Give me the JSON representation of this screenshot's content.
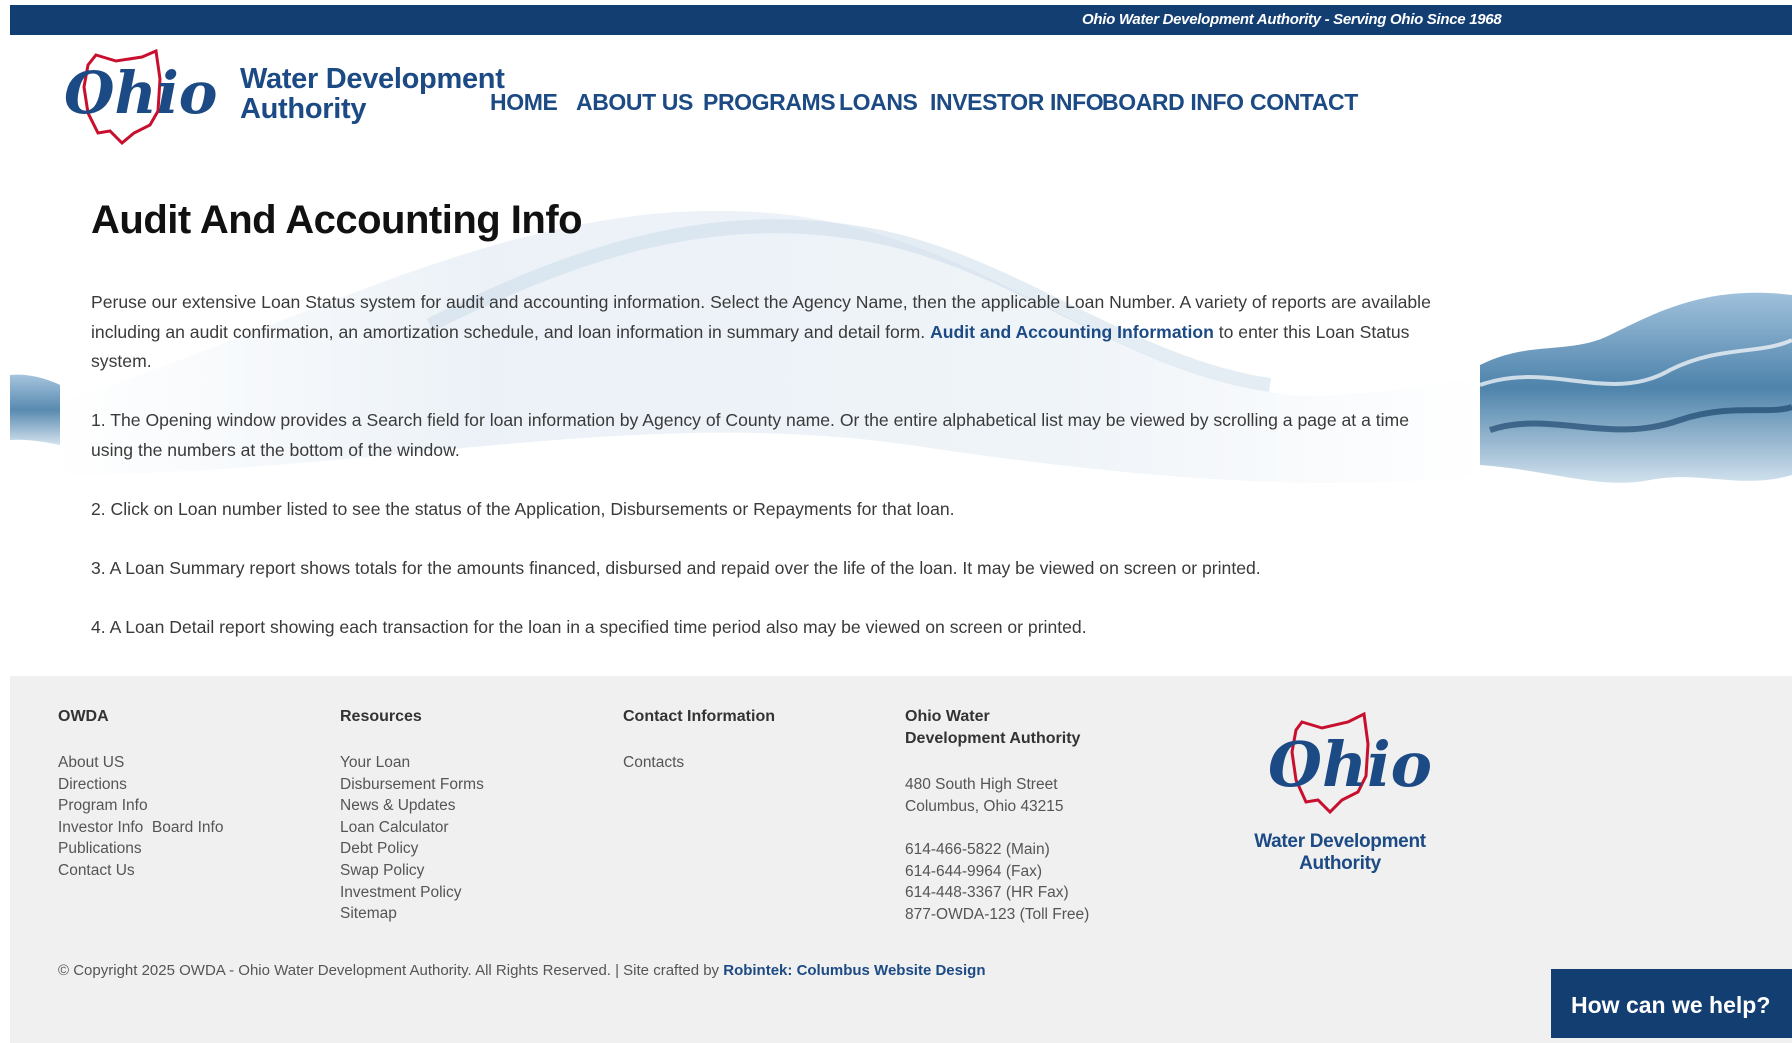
{
  "topbar": {
    "tagline": "Ohio Water Development Authority - Serving Ohio Since 1968"
  },
  "logo": {
    "line1": "Water Development",
    "line2": "Authority",
    "emblem_text": "Ohio"
  },
  "nav": {
    "items": [
      {
        "label": "HOME"
      },
      {
        "label": "ABOUT US"
      },
      {
        "label": "PROGRAMS"
      },
      {
        "label": "LOANS"
      },
      {
        "label": "INVESTOR INFO"
      },
      {
        "label": "BOARD INFO"
      },
      {
        "label": "CONTACT"
      }
    ]
  },
  "main": {
    "title": "Audit And Accounting Info",
    "intro_text": "Peruse our extensive Loan Status system for audit and accounting information. Select the Agency Name, then the applicable Loan Number. A variety of reports are available including an audit confirmation, an amortization schedule, and loan information in summary and detail form. ",
    "intro_link": "Audit and Accounting Information",
    "intro_suffix": " to enter this Loan Status system.",
    "steps": [
      "1. The Opening window provides a Search field for loan information by Agency of County name. Or the entire alphabetical list may be viewed by scrolling a page at a time using the numbers at the bottom of the window.",
      "2. Click on Loan number listed to see the status of the Application, Disbursements or Repayments for that loan.",
      "3. A Loan Summary report shows totals for the amounts financed, disbursed and repaid over the life of the loan. It may be viewed on screen or printed.",
      "4. A Loan Detail report showing each transaction for the loan in a specified time period also may be viewed on screen or printed."
    ]
  },
  "footer": {
    "owda": {
      "heading": "OWDA",
      "links": [
        "About US",
        "Directions",
        "Program Info",
        "Investor Info",
        "Board Info",
        "Publications",
        "Contact Us"
      ]
    },
    "resources": {
      "heading": "Resources",
      "links": [
        "Your Loan",
        "Disbursement Forms",
        "News & Updates",
        "Loan Calculator",
        "Debt Policy",
        "Swap Policy",
        "Investment Policy",
        "Sitemap"
      ]
    },
    "contact_info": {
      "heading": "Contact Information",
      "links": [
        "Contacts"
      ]
    },
    "address": {
      "heading_line1": "Ohio Water",
      "heading_line2": "Development Authority",
      "street": "480 South High Street",
      "city": "Columbus, Ohio 43215",
      "phones": [
        "614-466-5822 (Main)",
        "614-644-9964 (Fax)",
        "614-448-3367 (HR Fax)",
        "877-OWDA-123 (Toll Free)"
      ]
    },
    "logo": {
      "emblem_text": "Ohio",
      "line1": "Water Development",
      "line2": "Authority"
    },
    "copyright_text": "© Copyright 2025 OWDA - Ohio Water Development Authority. All Rights Reserved. | Site crafted by ",
    "copyright_link": "Robintek: Columbus Website Design"
  },
  "help_widget": {
    "label": "How can we help?"
  },
  "colors": {
    "brand_navy": "#123e72",
    "brand_blue": "#1c4a84",
    "ohio_red": "#c8102e",
    "footer_bg": "#f0f0f0"
  }
}
